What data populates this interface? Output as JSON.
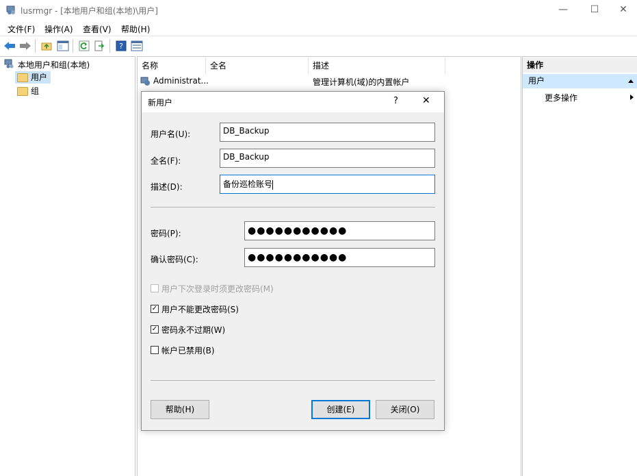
{
  "window": {
    "app_title": "lusrmgr - [本地用户和组(本地)\\用户]",
    "minimize_glyph": "—",
    "maximize_glyph": "☐",
    "close_glyph": "✕"
  },
  "menu": [
    "文件(F)",
    "操作(A)",
    "查看(V)",
    "帮助(H)"
  ],
  "toolbar": {
    "icons": [
      "back-icon",
      "forward-icon",
      "up-folder-icon",
      "show-hide-tree-icon",
      "refresh-icon",
      "export-list-icon",
      "help-icon",
      "properties-icon"
    ]
  },
  "tree": {
    "root": "本地用户和组(本地)",
    "items": [
      "用户",
      "组"
    ]
  },
  "list": {
    "columns": [
      "名称",
      "全名",
      "描述"
    ],
    "rows": [
      {
        "name": "Administrat...",
        "fullname": "",
        "description": "管理计算机(域)的内置帐户"
      }
    ]
  },
  "actions": {
    "title": "操作",
    "section": "用户",
    "more": "更多操作"
  },
  "dialog": {
    "title": "新用户",
    "help_glyph": "?",
    "close_glyph": "✕",
    "username_label": "用户名(U):",
    "username_value": "DB_Backup",
    "fullname_label": "全名(F):",
    "fullname_value": "DB_Backup",
    "description_label": "描述(D):",
    "description_value": "备份巡检账号",
    "password_label": "密码(P):",
    "password_mask": "●●●●●●●●●●●",
    "confirm_label": "确认密码(C):",
    "confirm_mask": "●●●●●●●●●●●",
    "checkboxes": [
      {
        "label": "用户下次登录时须更改密码(M)",
        "checked": false,
        "disabled": true
      },
      {
        "label": "用户不能更改密码(S)",
        "checked": true,
        "disabled": false
      },
      {
        "label": "密码永不过期(W)",
        "checked": true,
        "disabled": false
      },
      {
        "label": "帐户已禁用(B)",
        "checked": false,
        "disabled": false
      }
    ],
    "help_button": "帮助(H)",
    "create_button": "创建(E)",
    "close_button": "关闭(O)"
  },
  "colors": {
    "accent": "#0078d7",
    "selection": "#cde8ff"
  }
}
